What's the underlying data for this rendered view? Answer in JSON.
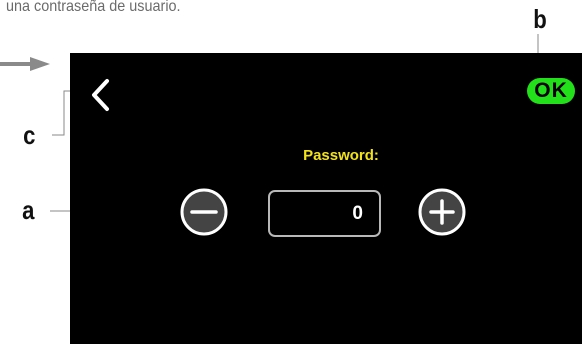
{
  "caption": "una contraseña de usuario.",
  "callouts": {
    "a": "a",
    "b": "b",
    "c": "c"
  },
  "screen": {
    "back_icon": "chevron-left-icon",
    "ok_label": "OK",
    "password_label": "Password:",
    "value": "0",
    "minus_icon": "minus-icon",
    "plus_icon": "plus-icon"
  },
  "colors": {
    "screen_background": "#000000",
    "ok_button": "#22e01a",
    "label_text": "#f2e21c",
    "value_border": "#b8b8b8",
    "callout_line": "#8a8a8a"
  }
}
